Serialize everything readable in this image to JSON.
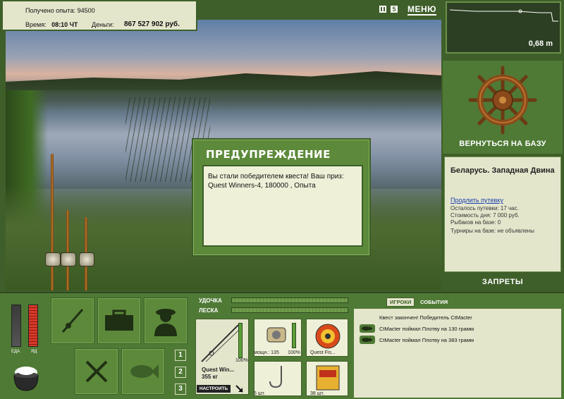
{
  "info": {
    "exp_label": "Получено опыта:",
    "exp_value": "94500",
    "time_label": "Время:",
    "time_value": "08:10 ЧТ",
    "money_label": "Деньги:",
    "money_value": "867 527 902 руб."
  },
  "topbar": {
    "sound_label": "5",
    "menu_label": "МЕНЮ"
  },
  "depth": {
    "value": "0,68 m"
  },
  "right_panel": {
    "return_label": "ВЕРНУТЬСЯ НА БАЗУ",
    "location_name": "Беларусь. Западная Двина",
    "extend_link": "Продлить путевку",
    "lines": [
      "Осталось путевки: 17 час.",
      "Стоимость дня: 7 000 руб.",
      "Рыбаков на базе: 0",
      "Турниры на базе: не объявлены"
    ],
    "bans_label": "ЗАПРЕТЫ"
  },
  "dialog": {
    "title": "ПРЕДУПРЕЖДЕНИЕ",
    "message": "Вы стали победителем квеста! Ваш приз: Quest Winners-4, 180000 , Опыта"
  },
  "status_bars": {
    "food_label": "ЕДА",
    "energy_label": "ЯД",
    "food_level": 1.0,
    "energy_level": 1.0
  },
  "pages": [
    "1",
    "2",
    "3"
  ],
  "tackle": {
    "rod_label": "УДОЧКА",
    "line_label": "ЛЕСКА",
    "rod_name": "Quest Win...",
    "rod_weight": "355 кг",
    "rod_condition": "100%",
    "setup_label": "НАСТРОИТЬ",
    "reel_power": "мощн.: 135",
    "reel_condition": "100%",
    "line_name": "Quest Fis...",
    "hooks_count": "5 шт.",
    "bait_count": "38 шт."
  },
  "events": {
    "tab_players": "ИГРОКИ",
    "tab_events": "СОБЫТИЯ",
    "items": [
      "Квест закончен! Победитель CtMacter",
      "CtMacter поймал Плотву на 130 грамм",
      "CtMacter поймал Плотву на 383 грамм"
    ]
  },
  "colors": {
    "panel_green": "#4f7a35",
    "dark_green": "#3d5f28",
    "light_panel": "#e4e6cc",
    "energy_red": "#d83a2a"
  }
}
